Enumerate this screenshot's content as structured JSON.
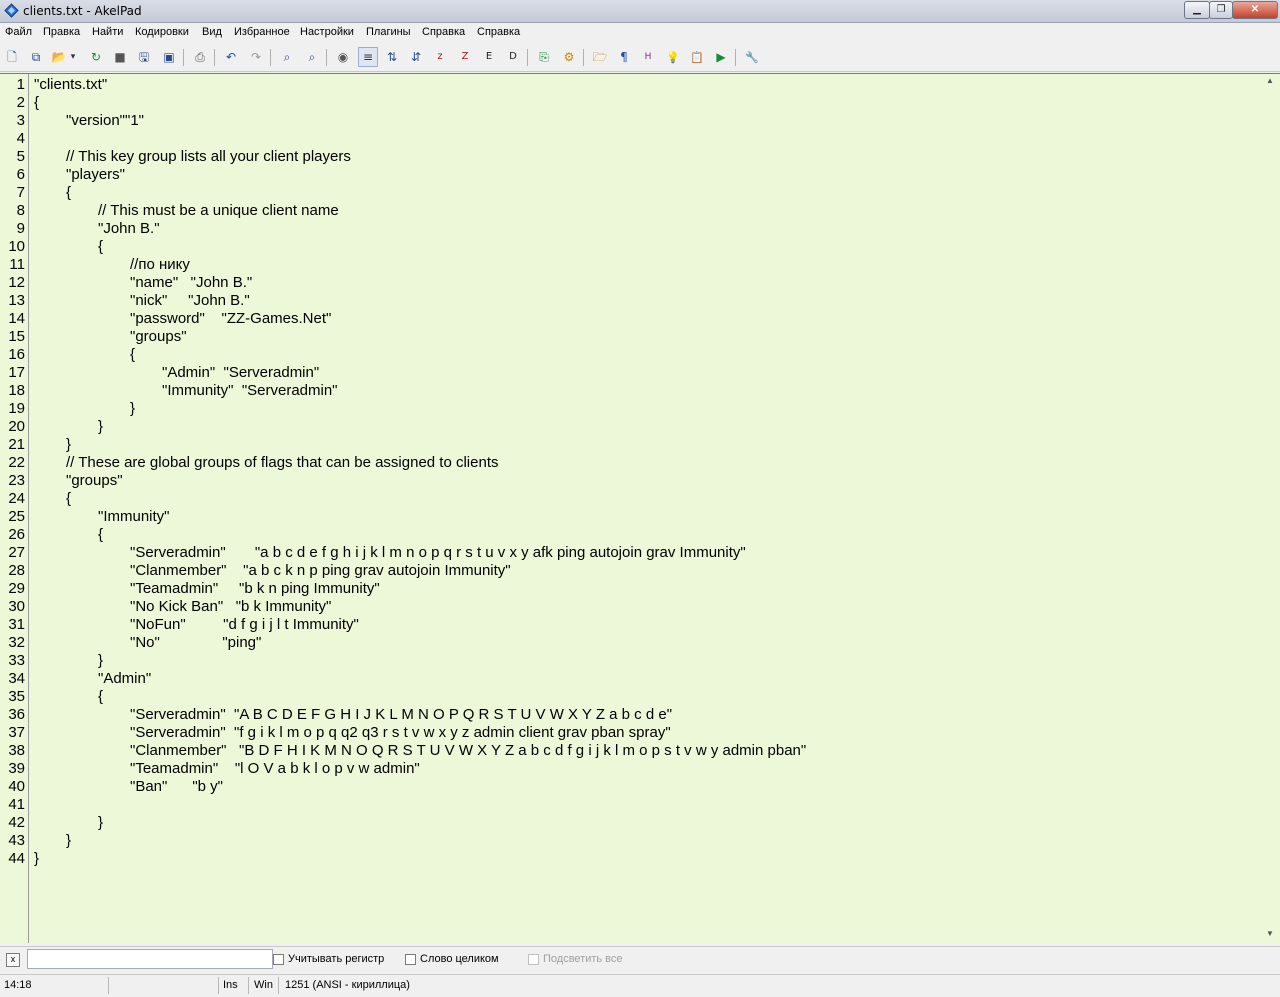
{
  "window": {
    "title": "clients.txt - AkelPad"
  },
  "menu": [
    "Файл",
    "Правка",
    "Найти",
    "Кодировки",
    "Вид",
    "Избранное",
    "Настройки",
    "Плагины",
    "Справка",
    "Справка"
  ],
  "toolbar": {
    "buttons": [
      {
        "name": "new-file-icon",
        "glyph": "🗋"
      },
      {
        "name": "new-window-icon",
        "glyph": "⧉"
      },
      {
        "name": "open-folder-icon",
        "glyph": "📂"
      },
      {
        "name": "dropdown-arrow-icon",
        "glyph": "▾"
      },
      {
        "name": "reopen-icon",
        "glyph": "↻"
      },
      {
        "name": "save-icon",
        "glyph": "■"
      },
      {
        "name": "save-as-icon",
        "glyph": "🖫"
      },
      {
        "name": "save-all-icon",
        "glyph": "▣"
      },
      {
        "name": "print-icon",
        "glyph": "⎙"
      },
      {
        "name": "undo-icon",
        "glyph": "↶"
      },
      {
        "name": "redo-icon",
        "glyph": "↷"
      },
      {
        "name": "find-icon",
        "glyph": "⌕"
      },
      {
        "name": "find-replace-icon",
        "glyph": "⌕"
      },
      {
        "name": "go-to-icon",
        "glyph": "◉"
      },
      {
        "name": "word-wrap-icon",
        "glyph": "≡"
      },
      {
        "name": "sort-ascending-icon",
        "glyph": "⇅"
      },
      {
        "name": "sort-descending-icon",
        "glyph": "⇵"
      },
      {
        "name": "lowercase-icon",
        "glyph": "z"
      },
      {
        "name": "uppercase-icon",
        "glyph": "Z"
      },
      {
        "name": "encoding-icon",
        "glyph": "Е"
      },
      {
        "name": "data-icon",
        "glyph": "D"
      },
      {
        "name": "copy-path-icon",
        "glyph": "⎘"
      },
      {
        "name": "settings-gear-icon",
        "glyph": "⚙"
      },
      {
        "name": "favorites-folder-icon",
        "glyph": "🗁"
      },
      {
        "name": "pilcrow-icon",
        "glyph": "¶"
      },
      {
        "name": "hex-icon",
        "glyph": "H"
      },
      {
        "name": "lightbulb-icon",
        "glyph": "💡"
      },
      {
        "name": "clipboard-icon",
        "glyph": "📋"
      },
      {
        "name": "run-icon",
        "glyph": "▶"
      },
      {
        "name": "tools-icon",
        "glyph": "🔧"
      }
    ]
  },
  "editor": {
    "lines": [
      "\"clients.txt\"",
      "{",
      "\t\"version\"\"1\"",
      "",
      "\t// This key group lists all your client players",
      "\t\"players\"",
      "\t{",
      "\t\t// This must be a unique client name",
      "\t\t\"John B.\"",
      "\t\t{",
      "\t\t\t//по нику",
      "\t\t\t\"name\"   \"John B.\"",
      "\t\t\t\"nick\"     \"John B.\"",
      "\t\t\t\"password\"    \"ZZ-Games.Net\"",
      "\t\t\t\"groups\"",
      "\t\t\t{",
      "\t\t\t\t\"Admin\"  \"Serveradmin\"",
      "\t\t\t\t\"Immunity\"  \"Serveradmin\"",
      "\t\t\t}",
      "\t\t}",
      "\t}",
      "\t// These are global groups of flags that can be assigned to clients",
      "\t\"groups\"",
      "\t{",
      "\t\t\"Immunity\"",
      "\t\t{",
      "\t\t\t\"Serveradmin\"       \"a b c d e f g h i j k l m n o p q r s t u v x y afk ping autojoin grav Immunity\"",
      "\t\t\t\"Clanmember\"    \"a b c k n p ping grav autojoin Immunity\"",
      "\t\t\t\"Teamadmin\"     \"b k n ping Immunity\"",
      "\t\t\t\"No Kick Ban\"   \"b k Immunity\"",
      "\t\t\t\"NoFun\"         \"d f g i j l t Immunity\"",
      "\t\t\t\"No\"               \"ping\"",
      "\t\t}",
      "\t\t\"Admin\"",
      "\t\t{",
      "\t\t\t\"Serveradmin\"  \"A B C D E F G H I J K L M N O P Q R S T U V W X Y Z a b c d e\"",
      "\t\t\t\"Serveradmin\"  \"f g i k l m o p q q2 q3 r s t v w x y z admin client grav pban spray\"",
      "\t\t\t\"Clanmember\"   \"B D F H I K M N O Q R S T U V W X Y Z a b c d f g i j k l m o p s t v w y admin pban\"",
      "\t\t\t\"Teamadmin\"    \"l O V a b k l o p v w admin\"",
      "\t\t\t\"Ban\"      \"b y\"",
      "",
      "\t\t}",
      "\t}",
      "}"
    ]
  },
  "search": {
    "value": "",
    "match_case_label": "Учитывать регистр",
    "whole_word_label": "Слово целиком",
    "highlight_all_label": "Подсветить все"
  },
  "status": {
    "position": "14:18",
    "insert_mode": "Ins",
    "line_ending": "Win",
    "encoding": "1251  (ANSI - кириллица)"
  }
}
